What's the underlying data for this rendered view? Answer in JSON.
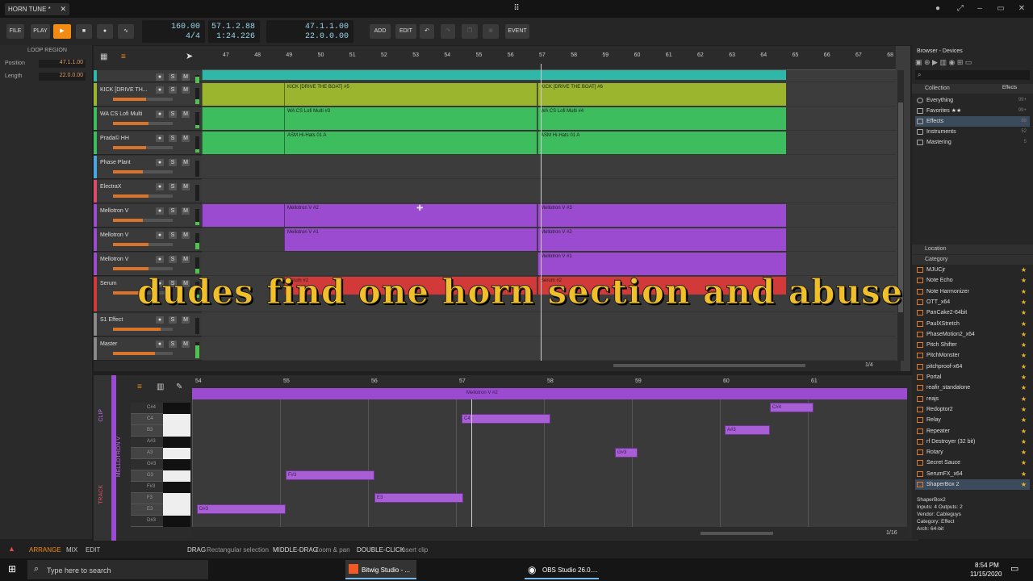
{
  "window": {
    "tab_title": "HORN TUNE *"
  },
  "toolbar": {
    "file": "FILE",
    "play": "PLAY",
    "tempo": "160.00",
    "signature": "4/4",
    "position": "57.1.2.88",
    "time": "1:24.226",
    "loop_start": "47.1.1.00",
    "loop_length": "22.0.0.00",
    "add": "ADD",
    "edit": "EDIT",
    "event": "EVENT"
  },
  "inspector": {
    "title": "LOOP REGION",
    "position_label": "Position",
    "position": "47.1.1.00",
    "length_label": "Length",
    "length": "22.0.0.00"
  },
  "ruler": [
    "47",
    "48",
    "49",
    "50",
    "51",
    "52",
    "53",
    "54",
    "55",
    "56",
    "57",
    "58",
    "59",
    "60",
    "61",
    "62",
    "63",
    "64",
    "65",
    "66",
    "67",
    "68"
  ],
  "tracks": [
    {
      "name": "",
      "color": "#2fb8a8",
      "vol": 0.5,
      "meter": 0.9
    },
    {
      "name": "KICK  [DRIVE TH...",
      "color": "#9bb52e",
      "vol": 0.55,
      "meter": 0.3
    },
    {
      "name": "WA CS Lofi Multi",
      "color": "#3dbd5d",
      "vol": 0.6,
      "meter": 0.2
    },
    {
      "name": "Prada© HH",
      "color": "#3dbd5d",
      "vol": 0.55,
      "meter": 0.2
    },
    {
      "name": "Phase Plant",
      "color": "#49a6e0",
      "vol": 0.5,
      "meter": 0
    },
    {
      "name": "ElectraX",
      "color": "#e04a6a",
      "vol": 0.6,
      "meter": 0
    },
    {
      "name": "Mellotron V",
      "color": "#9a4bd0",
      "vol": 0.5,
      "meter": 0.2
    },
    {
      "name": "Mellotron V",
      "color": "#9a4bd0",
      "vol": 0.6,
      "meter": 0.4
    },
    {
      "name": "Mellotron V",
      "color": "#9a4bd0",
      "vol": 0.6,
      "meter": 0.3
    },
    {
      "name": "Serum",
      "color": "#d23a3a",
      "vol": 0.55,
      "meter": 0.2
    },
    {
      "name": "S1 Effect",
      "color": "#888888",
      "vol": 0.8,
      "meter": 0
    },
    {
      "name": "Master",
      "color": "#888888",
      "vol": 0.7,
      "meter": 0.8
    }
  ],
  "clips": [
    {
      "label": "KICK  [DRIVE THE BOAT] #5",
      "color": "#9bb52e"
    },
    {
      "label": "KICK  [DRIVE THE BOAT] #6",
      "color": "#9bb52e"
    },
    {
      "label": "WA CS Lofi Multi #3",
      "color": "#3dbd5d"
    },
    {
      "label": "WA CS Lofi Multi #4",
      "color": "#3dbd5d"
    },
    {
      "label": "ASM Hi-Hats 01 A",
      "color": "#3dbd5d"
    },
    {
      "label": "ASM Hi-Hats 01 A",
      "color": "#3dbd5d"
    },
    {
      "label": "Mellotron V #2",
      "color": "#9a4bd0"
    },
    {
      "label": "Mellotron V #3",
      "color": "#9a4bd0"
    },
    {
      "label": "Mellotron V #1",
      "color": "#9a4bd0"
    },
    {
      "label": "Mellotron V #2",
      "color": "#9a4bd0"
    },
    {
      "label": "Mellotron V #1",
      "color": "#9a4bd0"
    },
    {
      "label": "Serum #1",
      "color": "#d23a3a"
    },
    {
      "label": "Serum #2",
      "color": "#d23a3a"
    }
  ],
  "subtitle": "dudes find one horn section and abuse it",
  "zoom_arrange": "1/4",
  "detail": {
    "ruler": [
      "54",
      "55",
      "56",
      "57",
      "58",
      "59",
      "60",
      "61"
    ],
    "clip_name": "Mellotron V #2",
    "side_labels": [
      "CLIP",
      "MELLOTRON V",
      "TRACK"
    ],
    "keys": [
      "C#4",
      "C4",
      "B3",
      "A#3",
      "A3",
      "G#3",
      "G3",
      "F#3",
      "F3",
      "E3",
      "D#3"
    ],
    "notes": [
      {
        "pitch": "C#4"
      },
      {
        "pitch": "C4"
      },
      {
        "pitch": "A#3"
      },
      {
        "pitch": "G#3"
      },
      {
        "pitch": "F#3"
      },
      {
        "pitch": "E3"
      },
      {
        "pitch": "D#3"
      }
    ],
    "zoom": "1/16"
  },
  "browser": {
    "title": "Browser - Devices",
    "filter": "Effects",
    "collection_label": "Collection",
    "collection": [
      {
        "label": "Everything",
        "count": "99+"
      },
      {
        "label": "Favorites ★★",
        "count": "99+"
      },
      {
        "label": "Effects",
        "count": "88"
      },
      {
        "label": "Instruments",
        "count": "52"
      },
      {
        "label": "Mastering",
        "count": "5"
      }
    ],
    "location_label": "Location",
    "category_label": "Category",
    "devices": [
      "MJUCjr",
      "Note Echo",
      "Note Harmonizer",
      "OTT_x64",
      "PanCake2-64bit",
      "PaulXStretch",
      "PhaseMotion2_x64",
      "Pitch Shifter",
      "PitchMonster",
      "pitchproof-x64",
      "Portal",
      "reafir_standalone",
      "reajs",
      "Redoptor2",
      "Relay",
      "Repeater",
      "rf Destroyer (32 bit)",
      "Rotary",
      "Secret Sauce",
      "SerumFX_x64",
      "ShaperBox 2"
    ],
    "info": [
      "ShaperBox2",
      "Inputs: 4  Outputs: 2",
      "Vendor: Cableguys",
      "Category: Effect",
      "Arch: 64-bit"
    ]
  },
  "status": {
    "arrange": "ARRANGE",
    "mix": "MIX",
    "edit": "EDIT",
    "drag": "DRAG",
    "drag_hint": "Rectangular selection",
    "middle": "MIDDLE-DRAG",
    "middle_hint": "Zoom & pan",
    "dbl": "DOUBLE-CLICK",
    "dbl_hint": "Insert clip"
  },
  "taskbar": {
    "search": "Type here to search",
    "bitwig": "Bitwig Studio - ...",
    "obs": "OBS Studio 26.0....",
    "time": "8:54 PM",
    "date": "11/15/2020"
  }
}
